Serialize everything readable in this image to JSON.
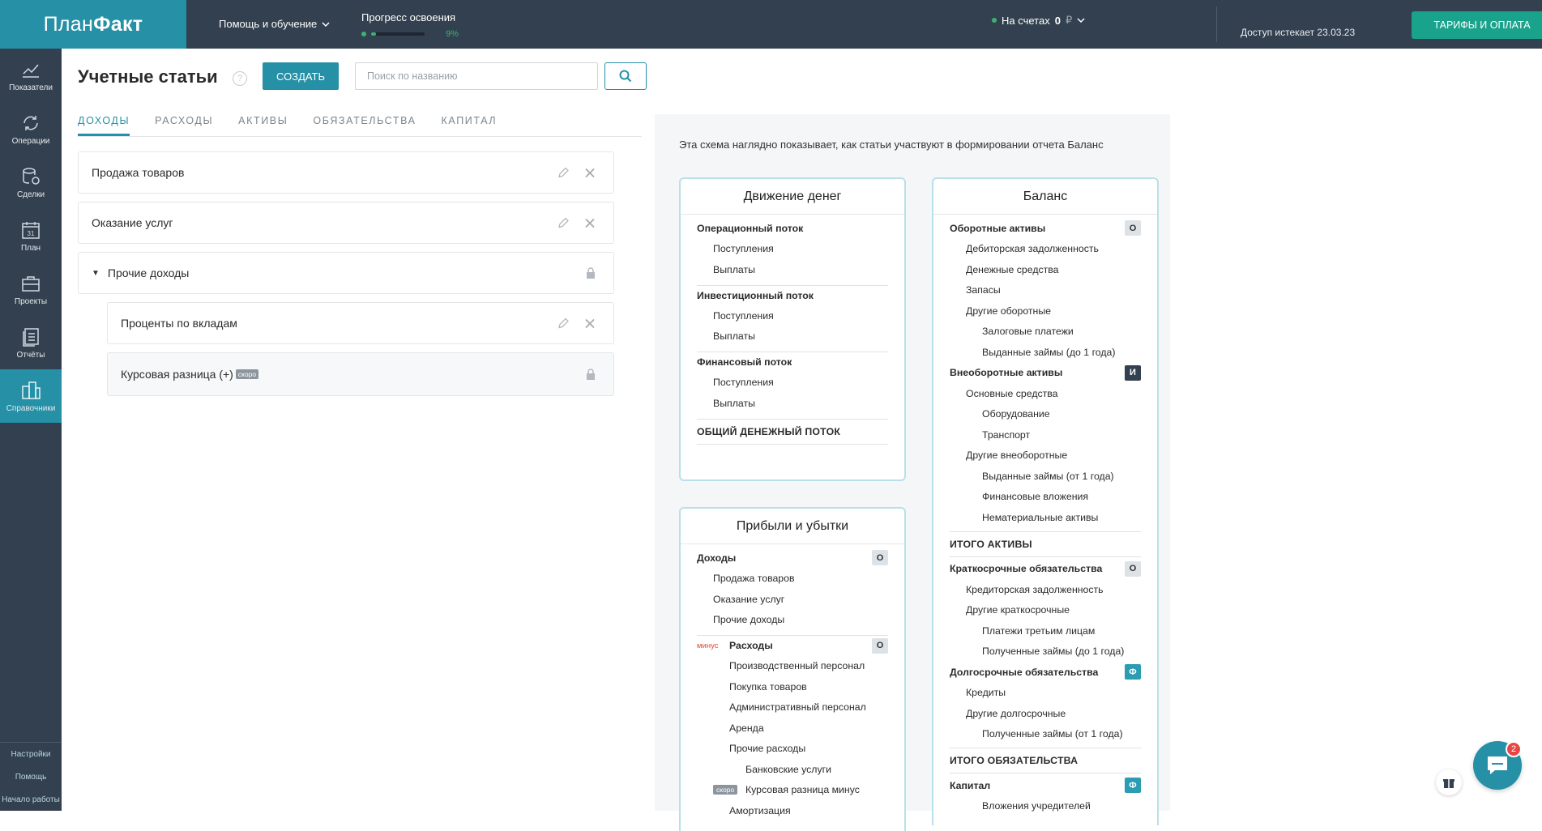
{
  "brand": {
    "logo_part1": "План",
    "logo_part2": "Факт"
  },
  "header": {
    "help_label": "Помощь и обучение",
    "progress_label": "Прогресс освоения",
    "progress_value": "9%",
    "progress_fraction": 0.09,
    "accounts_prefix": "На счетах",
    "accounts_amount": "0",
    "accounts_currency": "₽",
    "access_text": "Доступ истекает 23.03.23",
    "tariff_button": "ТАРИФЫ И ОПЛАТА"
  },
  "sidebar": {
    "items": [
      {
        "label": "Показатели",
        "icon": "chart-icon"
      },
      {
        "label": "Операции",
        "icon": "refresh-icon"
      },
      {
        "label": "Сделки",
        "icon": "deals-icon"
      },
      {
        "label": "План",
        "icon": "calendar-icon"
      },
      {
        "label": "Проекты",
        "icon": "briefcase-icon"
      },
      {
        "label": "Отчёты",
        "icon": "reports-icon"
      },
      {
        "label": "Справочники",
        "icon": "directory-icon",
        "active": true
      }
    ],
    "calendar_day": "31",
    "bottom": [
      "Настройки",
      "Помощь",
      "Начало работы"
    ]
  },
  "page": {
    "title": "Учетные статьи",
    "help_mark": "?",
    "create_button": "СОЗДАТЬ",
    "search_placeholder": "Поиск по названию",
    "tabs": [
      "ДОХОДЫ",
      "РАСХОДЫ",
      "АКТИВЫ",
      "ОБЯЗАТЕЛЬСТВА",
      "КАПИТАЛ"
    ],
    "active_tab": 0
  },
  "articles": [
    {
      "name": "Продажа товаров",
      "editable": true
    },
    {
      "name": "Оказание услуг",
      "editable": true
    },
    {
      "name": "Прочие доходы",
      "locked": true,
      "expanded": true
    },
    {
      "name": "Проценты по вкладам",
      "editable": true,
      "child": true
    },
    {
      "name": "Курсовая разница (+)",
      "locked": true,
      "child": true,
      "soon": "скоро"
    }
  ],
  "scheme": {
    "description": "Эта схема наглядно показывает, как статьи участвуют в формировании отчета Баланс",
    "cashflow": {
      "title": "Движение денег",
      "groups": [
        {
          "name": "Операционный поток",
          "rows": [
            "Поступления",
            "Выплаты"
          ]
        },
        {
          "name": "Инвестиционный поток",
          "rows": [
            "Поступления",
            "Выплаты"
          ]
        },
        {
          "name": "Финансовый поток",
          "rows": [
            "Поступления",
            "Выплаты"
          ]
        }
      ],
      "total": "ОБЩИЙ ДЕНЕЖНЫЙ ПОТОК"
    },
    "pnl": {
      "title": "Прибыли и убытки",
      "income": {
        "name": "Доходы",
        "badge": "О",
        "rows": [
          "Продажа товаров",
          "Оказание услуг",
          "Прочие доходы"
        ]
      },
      "minus_label": "минус",
      "expenses": {
        "name": "Расходы",
        "badge": "О",
        "rows": [
          "Производственный персонал",
          "Покупка товаров",
          "Административный персонал",
          "Аренда",
          "Прочие расходы"
        ],
        "sub": [
          "Банковские услуги"
        ]
      },
      "soon_label": "скоро",
      "soon_row": "Курсовая разница минус",
      "cut_row": "Амортизация"
    },
    "balance": {
      "title": "Баланс",
      "current_assets": {
        "name": "Оборотные активы",
        "badge": "О"
      },
      "current_rows": [
        {
          "t": "Дебиторская задолженность",
          "l": 1
        },
        {
          "t": "Денежные средства",
          "l": 1
        },
        {
          "t": "Запасы",
          "l": 1
        },
        {
          "t": "Другие оборотные",
          "l": 1
        },
        {
          "t": "Залоговые платежи",
          "l": 2
        },
        {
          "t": "Выданные займы (до 1 года)",
          "l": 2
        }
      ],
      "noncurrent_assets": {
        "name": "Внеоборотные активы",
        "badge": "И"
      },
      "noncurrent_rows": [
        {
          "t": "Основные средства",
          "l": 1
        },
        {
          "t": "Оборудование",
          "l": 2
        },
        {
          "t": "Транспорт",
          "l": 2
        },
        {
          "t": "Другие внеоборотные",
          "l": 1
        },
        {
          "t": "Выданные займы (от 1 года)",
          "l": 2
        },
        {
          "t": "Финансовые вложения",
          "l": 2
        },
        {
          "t": "Нематериальные активы",
          "l": 2
        }
      ],
      "total_assets": "ИТОГО АКТИВЫ",
      "short_liab": {
        "name": "Краткосрочные обязательства",
        "badge": "О"
      },
      "short_rows": [
        {
          "t": "Кредиторская задолженность",
          "l": 1
        },
        {
          "t": "Другие краткосрочные",
          "l": 1
        },
        {
          "t": "Платежи третьим лицам",
          "l": 2
        },
        {
          "t": "Полученные займы (до 1 года)",
          "l": 2
        }
      ],
      "long_liab": {
        "name": "Долгосрочные обязательства",
        "badge": "Ф"
      },
      "long_rows": [
        {
          "t": "Кредиты",
          "l": 1
        },
        {
          "t": "Другие долгосрочные",
          "l": 1
        },
        {
          "t": "Полученные займы (от 1 года)",
          "l": 2
        }
      ],
      "total_liab": "ИТОГО ОБЯЗАТЕЛЬСТВА",
      "capital": {
        "name": "Капитал",
        "badge": "Ф"
      },
      "capital_cut": "Вложения учредителей"
    }
  },
  "chat": {
    "unread": "2"
  },
  "colors": {
    "accent": "#2590a6",
    "topbar": "#33404f",
    "green": "#1aa38c",
    "danger": "#e94545"
  }
}
